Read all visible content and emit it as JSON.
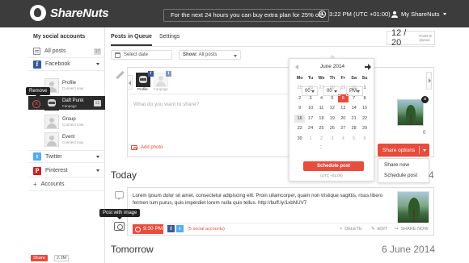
{
  "app": {
    "name": "ShareNuts"
  },
  "topbar": {
    "promo": "For the next 24 hours you can buy extra plan for 25% off",
    "clock": "3:22 PM (UTC +01:00)",
    "account": "My ShareNuts"
  },
  "sidebar": {
    "title": "My social accounts",
    "all_posts": {
      "label": "All posts",
      "count": "17"
    },
    "facebook": {
      "label": "Facebook"
    },
    "fb_accounts": [
      {
        "name": "Profile",
        "sub": "Connect now"
      },
      {
        "name": "Daft Punk",
        "sub": "Fanpage",
        "count": "12"
      },
      {
        "name": "Group",
        "sub": "Connect now"
      },
      {
        "name": "Event",
        "sub": "Connect now"
      }
    ],
    "remove_tooltip": "Remove",
    "twitter": {
      "label": "Twitter"
    },
    "pinterest": {
      "label": "Pinterest"
    },
    "accounts": {
      "label": "Accounts"
    },
    "share_button": "Share",
    "share_count": "2.3M"
  },
  "tabs": {
    "posts_in_queue": "Posts in Queue",
    "settings": "Settings"
  },
  "counter": {
    "value": "12 / 20",
    "label": "Posts in Queue"
  },
  "filters": {
    "date_label": "Select date",
    "show_prefix": "Show:",
    "show_value": "All posts"
  },
  "composer": {
    "placeholder": "What do you want to share?",
    "profile_labels": [
      "Profile",
      "Fanpage"
    ],
    "add_photo": "Add photo",
    "image_count": "0",
    "share_options": "Share options",
    "share_menu": [
      "Share now",
      "Schedule post"
    ]
  },
  "calendar": {
    "month": "June 2014",
    "weekdays": [
      "Mo",
      "Tu",
      "We",
      "Th",
      "Fr",
      "Sa",
      "Su"
    ],
    "days": [
      {
        "d": "25",
        "m": true
      },
      {
        "d": "26",
        "m": true
      },
      {
        "d": "27",
        "m": true
      },
      {
        "d": "28",
        "m": true
      },
      {
        "d": "29",
        "m": true
      },
      {
        "d": "30",
        "m": true
      },
      {
        "d": "1"
      },
      {
        "d": "2"
      },
      {
        "d": "3"
      },
      {
        "d": "4"
      },
      {
        "d": "5"
      },
      {
        "d": "6",
        "s": true
      },
      {
        "d": "7"
      },
      {
        "d": "8"
      },
      {
        "d": "9"
      },
      {
        "d": "10"
      },
      {
        "d": "11"
      },
      {
        "d": "12"
      },
      {
        "d": "13"
      },
      {
        "d": "14"
      },
      {
        "d": "15"
      },
      {
        "d": "16",
        "t": true
      },
      {
        "d": "17"
      },
      {
        "d": "18"
      },
      {
        "d": "19"
      },
      {
        "d": "20"
      },
      {
        "d": "21"
      },
      {
        "d": "22"
      },
      {
        "d": "23"
      },
      {
        "d": "24"
      },
      {
        "d": "25"
      },
      {
        "d": "26"
      },
      {
        "d": "27"
      },
      {
        "d": "28"
      },
      {
        "d": "29"
      },
      {
        "d": "30"
      },
      {
        "d": "1",
        "m": true
      },
      {
        "d": "2",
        "m": true
      },
      {
        "d": "3",
        "m": true
      },
      {
        "d": "4",
        "m": true
      },
      {
        "d": "5",
        "m": true
      },
      {
        "d": "6",
        "m": true
      }
    ],
    "hour": "00",
    "minute": "00",
    "ampm": "PM",
    "schedule_button": "Schedule post",
    "timezone": "(UTC +01:00)"
  },
  "queue": {
    "today_heading": "Today",
    "today_count": "4",
    "post_text": "Lorem ipsum dolor sit amet, consectetur adipiscing elit. Proin ullamcorper, quam non tristique sagittis, risus libero fermen tum purus, quis imperdiet lorem nulla quis tellus. http://buff.ly/1xbNUV7",
    "tooltip": "Post with image",
    "time": "9:30 PM",
    "accounts_label": "(5 social accounts)",
    "delete": "DELETE",
    "edit": "EDIT",
    "share_now": "SHARE NOW",
    "tomorrow_heading": "Tomorrow",
    "tomorrow_date": "6 June 2014"
  },
  "colors": {
    "accent": "#e74c3c",
    "topbar": "#3c3c3c",
    "facebook": "#3b5998",
    "twitter": "#55acee",
    "pinterest": "#cb2027"
  }
}
